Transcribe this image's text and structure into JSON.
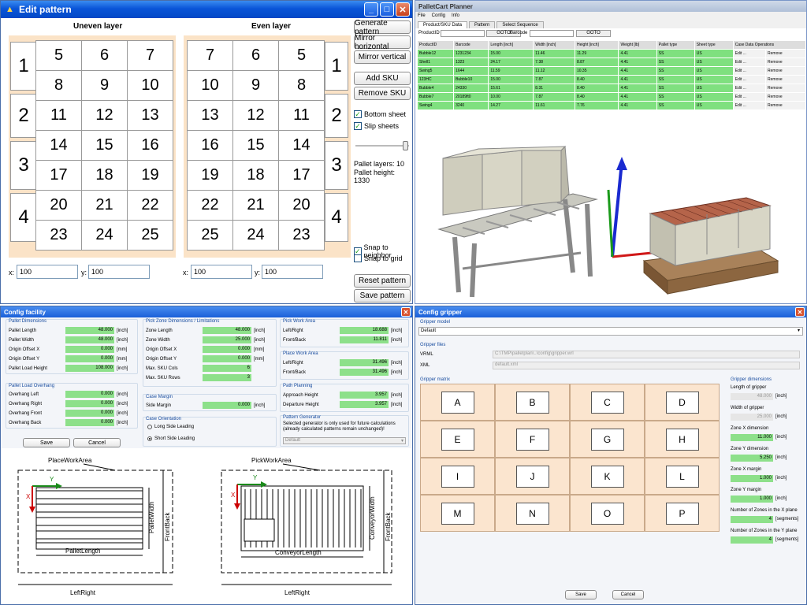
{
  "edit_pattern": {
    "title": "Edit pattern",
    "uneven_title": "Uneven layer",
    "even_title": "Even layer",
    "uneven_rows": [
      "5",
      "6",
      "7",
      "8",
      "9",
      "10",
      "11",
      "12",
      "13",
      "14",
      "15",
      "16",
      "17",
      "18",
      "19",
      "20",
      "21",
      "22",
      "23",
      "24",
      "25"
    ],
    "even_rows": [
      "7",
      "6",
      "5",
      "10",
      "9",
      "8",
      "13",
      "12",
      "11",
      "16",
      "15",
      "14",
      "19",
      "18",
      "17",
      "22",
      "21",
      "20",
      "25",
      "24",
      "23"
    ],
    "row_numbers": [
      "1",
      "2",
      "3",
      "4"
    ],
    "buttons": {
      "generate": "Generate pattern",
      "mirror_h": "Mirror horizontal",
      "mirror_v": "Mirror vertical",
      "add_sku": "Add SKU",
      "remove_sku": "Remove SKU",
      "reset": "Reset pattern",
      "save": "Save pattern"
    },
    "bottom_sheet": "Bottom sheet",
    "slip_sheets": "Slip sheets",
    "pallet_layers": "Pallet layers: 10",
    "pallet_height": "Pallet height: 1330",
    "snap_neighbor": "Snap to neighbor",
    "snap_grid": "Snap to grid",
    "x_label": "x:",
    "y_label": "y:",
    "x1": "100",
    "y1": "100",
    "x2": "100",
    "y2": "100"
  },
  "pallet_manager": {
    "title": "PalletCart Planner",
    "menu": [
      "File",
      "Config",
      "Info"
    ],
    "tabs": [
      "Product/SKU Data",
      "Pattern",
      "Select Sequence"
    ],
    "productid_label": "ProductID",
    "barcode_label": "Barcode",
    "goto": "GOTO",
    "headers": [
      "ProductID",
      "Barcode",
      "Length [inch]",
      "Width [inch]",
      "Height [inch]",
      "Weight [lb]",
      "Pallet type",
      "Sheet type",
      "Case Data Operations"
    ],
    "rows": [
      [
        "Bubble12",
        "1231234",
        "15.00",
        "11.46",
        "11.29",
        "4.41",
        "SS",
        "US"
      ],
      [
        "Shell1",
        "1323",
        "24.17",
        "7.38",
        "8.87",
        "4.41",
        "SS",
        "US"
      ],
      [
        "Swing5",
        "1644",
        "11.59",
        "11.12",
        "10.35",
        "4.41",
        "SS",
        "US"
      ],
      [
        "123HC",
        "Bubble10",
        "15.00",
        "7.87",
        "8.40",
        "4.41",
        "SS",
        "US"
      ],
      [
        "Bubble4",
        "24330",
        "15.61",
        "8.31",
        "8.40",
        "4.41",
        "SS",
        "US"
      ],
      [
        "Bubble7",
        "20189ft0",
        "10.00",
        "7.87",
        "8.40",
        "4.41",
        "SS",
        "US"
      ],
      [
        "Swing4",
        "3240",
        "14.27",
        "11.61",
        "7.76",
        "4.41",
        "SS",
        "US"
      ]
    ],
    "edit": "Edit ...",
    "remove": "Remove"
  },
  "config_facility": {
    "title": "Config facility",
    "pallet_dim": {
      "title": "Pallet Dimensions",
      "rows": [
        [
          "Pallet Length",
          "48.000",
          "[inch]"
        ],
        [
          "Pallet Width",
          "48.000",
          "[inch]"
        ],
        [
          "Origin Offset X",
          "0.000",
          "[mm]"
        ],
        [
          "Origin Offset Y",
          "0.000",
          "[mm]"
        ],
        [
          "Pallet Load Height",
          "108.000",
          "[inch]"
        ]
      ]
    },
    "overhang": {
      "title": "Pallet Load Overhang",
      "rows": [
        [
          "Overhang Left",
          "0.000",
          "[inch]"
        ],
        [
          "Overhang Right",
          "0.000",
          "[inch]"
        ],
        [
          "Overhang Front",
          "0.000",
          "[inch]"
        ],
        [
          "Overhang Back",
          "0.000",
          "[inch]"
        ]
      ]
    },
    "pickzone": {
      "title": "Pick Zone Dimensions / Limitations",
      "rows": [
        [
          "Zone Length",
          "48.000",
          "[inch]"
        ],
        [
          "Zone Width",
          "25.000",
          "[inch]"
        ],
        [
          "Origin Offset X",
          "0.000",
          "[mm]"
        ],
        [
          "Origin Offset Y",
          "0.000",
          "[mm]"
        ],
        [
          "Max. SKU Cols",
          "6",
          ""
        ],
        [
          "Max. SKU Rows",
          "3",
          ""
        ]
      ]
    },
    "case_margin": {
      "title": "Case Margin",
      "rows": [
        [
          "Side Margin",
          "0.000",
          "[inch]"
        ]
      ]
    },
    "case_orient": {
      "title": "Case Orientation",
      "long": "Long Side Leading",
      "short": "Short Side Leading"
    },
    "pick_work": {
      "title": "Pick Work Area",
      "rows": [
        [
          "Left/Right",
          "18.688",
          "[inch]"
        ],
        [
          "Front/Back",
          "11.811",
          "[inch]"
        ]
      ]
    },
    "place_work": {
      "title": "Place Work Area",
      "rows": [
        [
          "Left/Right",
          "31.496",
          "[inch]"
        ],
        [
          "Front/Back",
          "31.496",
          "[inch]"
        ]
      ]
    },
    "path": {
      "title": "Path Planning",
      "rows": [
        [
          "Approach Height",
          "3.957",
          "[inch]"
        ],
        [
          "Departure Height",
          "3.957",
          "[inch]"
        ]
      ]
    },
    "pattern_gen": {
      "title": "Pattern Generator",
      "text": "Selected generator is only used for future calculations (already calculated patterns remain unchanged)!",
      "value": "Default"
    },
    "save": "Save",
    "cancel": "Cancel",
    "diag_place": "PlaceWorkArea",
    "diag_pick": "PickWorkArea",
    "pallet_length": "PalletLength",
    "pallet_width": "PalletWidth",
    "front_back": "FrontBack",
    "left_right": "LeftRight",
    "conveyor_length": "ConveyorLength",
    "conveyor_width": "ConveyorWidth",
    "x_axis": "X",
    "y_axis": "Y"
  },
  "config_gripper": {
    "title": "Config gripper",
    "model_label": "Gripper model",
    "model_value": "Default",
    "files_label": "Gripper files",
    "vrml_label": "VRML",
    "vrml_value": "C:\\TMP\\palletplan\\..\\config\\gripper.wrl",
    "xml_label": "XML",
    "xml_value": "default.xml",
    "matrix_label": "Gripper matrix",
    "cells": [
      "A",
      "B",
      "C",
      "D",
      "E",
      "F",
      "G",
      "H",
      "I",
      "J",
      "K",
      "L",
      "M",
      "N",
      "O",
      "P"
    ],
    "dims_title": "Gripper dimensions",
    "dims": [
      [
        "Length of gripper",
        "48.000",
        "[inch]"
      ],
      [
        "Width of gripper",
        "25.000",
        "[inch]"
      ],
      [
        "Zone X dimension",
        "11.000",
        "[inch]"
      ],
      [
        "Zone Y dimension",
        "5.250",
        "[inch]"
      ],
      [
        "Zone X margin",
        "1.000",
        "[inch]"
      ],
      [
        "Zone Y margin",
        "1.000",
        "[inch]"
      ],
      [
        "Number of Zones in the X plane",
        "4",
        "[segments]"
      ],
      [
        "Number of Zones in the Y plane",
        "4",
        "[segments]"
      ]
    ],
    "save": "Save",
    "cancel": "Cancel"
  }
}
